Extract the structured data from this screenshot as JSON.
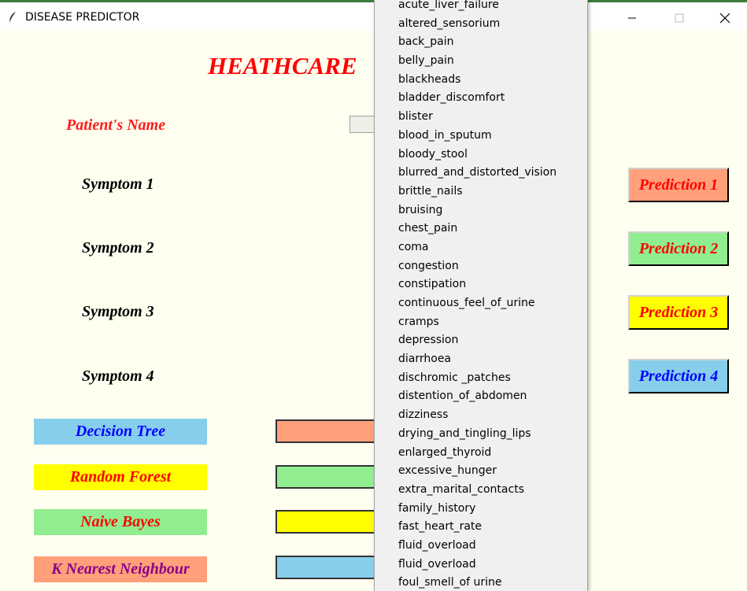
{
  "window": {
    "title": "DISEASE PREDICTOR",
    "icon": "feather-icon",
    "controls": [
      "minimize-icon",
      "maximize-icon",
      "close-icon"
    ]
  },
  "form": {
    "heading": "HEATHCARE",
    "patient_name_label": "Patient's Name",
    "patient_name_value": "",
    "symptom_labels": [
      "Symptom 1",
      "Symptom 2",
      "Symptom 3",
      "Symptom 4"
    ]
  },
  "prediction_buttons": [
    "Prediction 1",
    "Prediction 2",
    "Prediction 3",
    "Prediction 4"
  ],
  "algorithms": [
    "Decision Tree",
    "Random Forest",
    "Naive Bayes",
    "K Nearest Neighbour"
  ],
  "results": [
    "",
    "",
    "",
    ""
  ],
  "dropdown": {
    "options": [
      "acute_liver_failure",
      "altered_sensorium",
      "back_pain",
      "belly_pain",
      "blackheads",
      "bladder_discomfort",
      "blister",
      "blood_in_sputum",
      "bloody_stool",
      "blurred_and_distorted_vision",
      "brittle_nails",
      "bruising",
      "chest_pain",
      "coma",
      "congestion",
      "constipation",
      "continuous_feel_of_urine",
      "cramps",
      "depression",
      "diarrhoea",
      "dischromic _patches",
      "distention_of_abdomen",
      "dizziness",
      "drying_and_tingling_lips",
      "enlarged_thyroid",
      "excessive_hunger",
      "extra_marital_contacts",
      "family_history",
      "fast_heart_rate",
      "fluid_overload",
      "fluid_overload",
      "foul_smell_of urine"
    ]
  },
  "colors": {
    "background": "#fffff0",
    "heading": "#ff0000",
    "salmon": "#ffa07a",
    "light_green": "#90ee90",
    "yellow": "#ffff00",
    "sky_blue": "#87ceeb"
  }
}
